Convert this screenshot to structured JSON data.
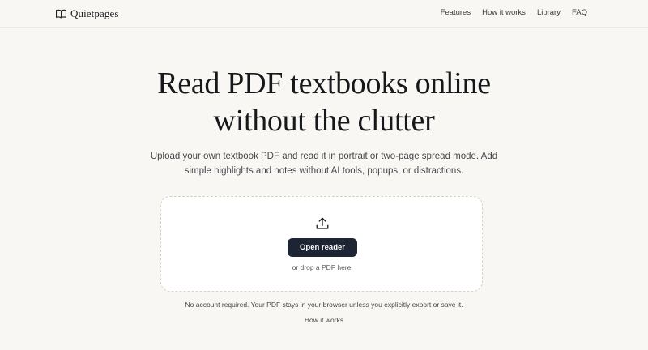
{
  "nav": {
    "brand": "Quietpages",
    "brand_icon": "book-open-icon",
    "links": [
      "Features",
      "How it works",
      "Library",
      "FAQ"
    ]
  },
  "hero": {
    "title_line1": "Read PDF textbooks online",
    "title_line2": "without the clutter",
    "subtitle": "Upload your own textbook PDF and read it in portrait or two-page spread mode. Add simple highlights and notes without AI tools, popups, or distractions."
  },
  "dropzone": {
    "icon": "upload-icon",
    "button_label": "Open reader",
    "hint": "or drop a PDF here"
  },
  "footer": {
    "note": "No account required. Your PDF stays in your browser unless you explicitly export or save it.",
    "link": "How it works"
  },
  "colors": {
    "background": "#f8f7f3",
    "button": "#1d2433",
    "text": "#1f2024"
  }
}
